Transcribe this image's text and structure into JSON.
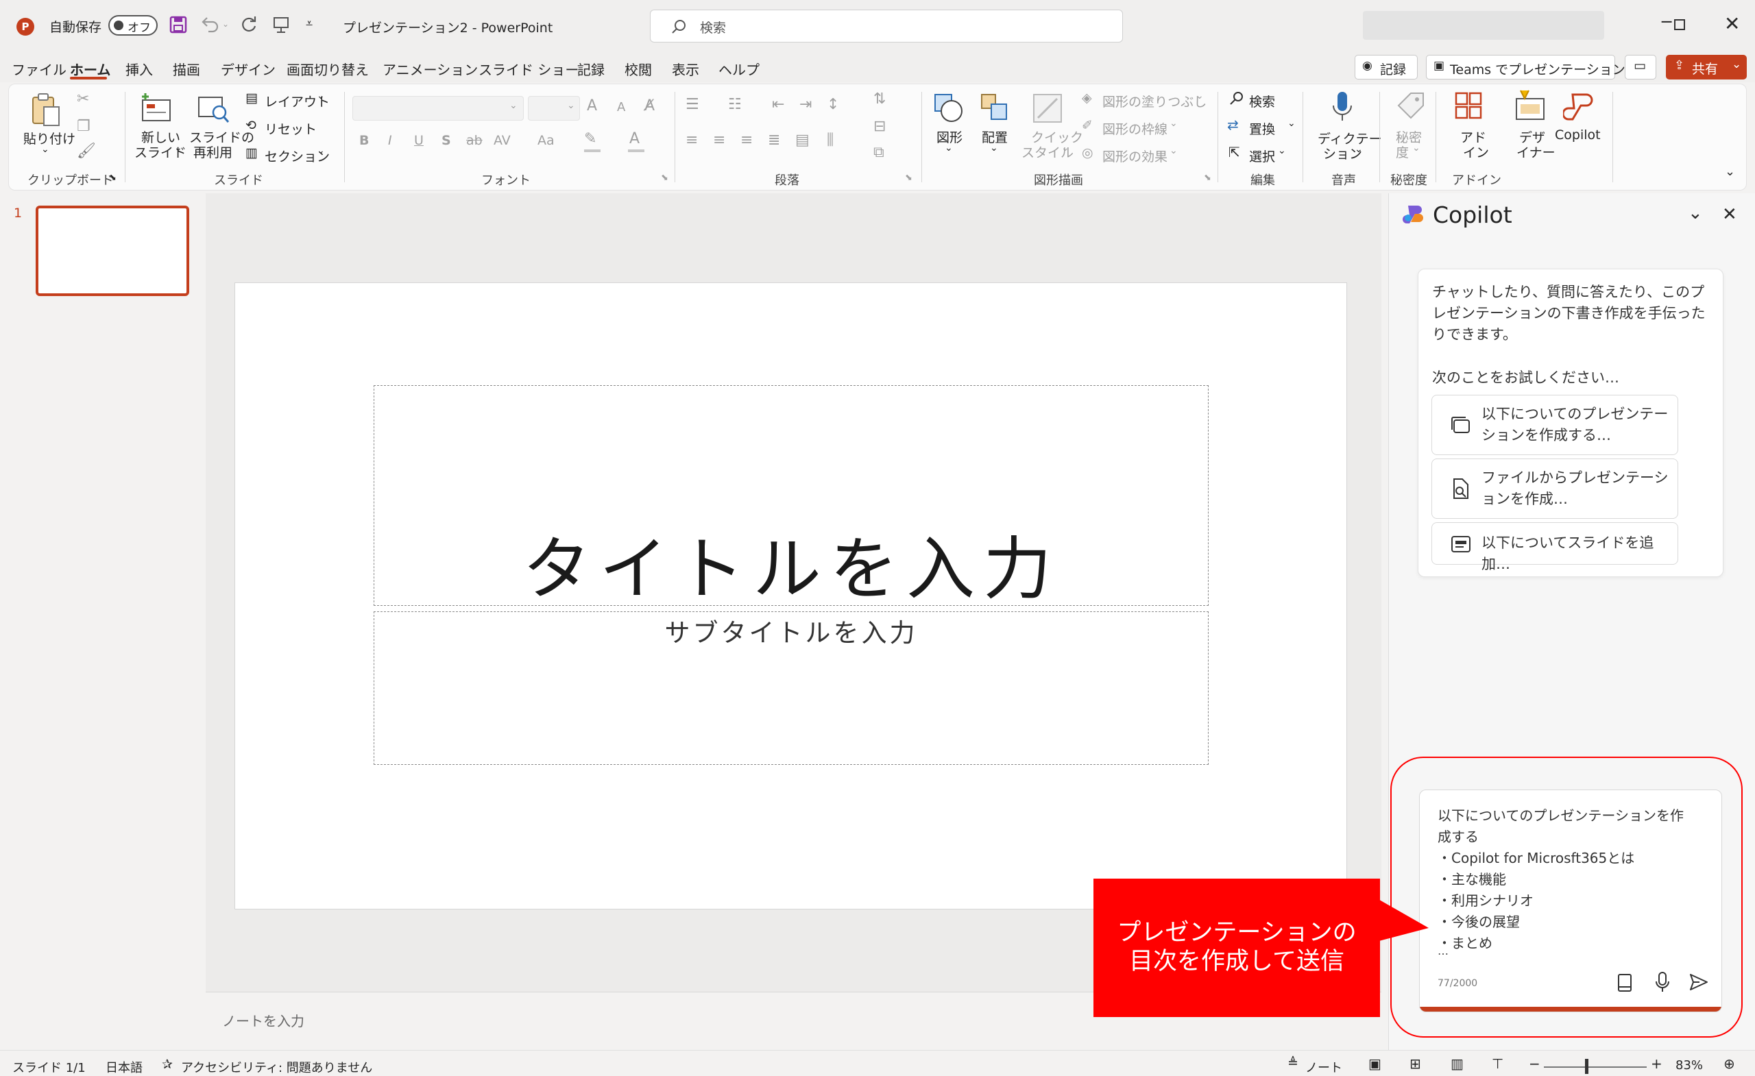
{
  "titlebar": {
    "autosave": "自動保存",
    "toggle": "オフ",
    "doc_title": "プレゼンテーション2 - PowerPoint",
    "search_placeholder": "検索"
  },
  "menu_tabs": [
    "ファイル",
    "ホーム",
    "挿入",
    "描画",
    "デザイン",
    "画面切り替え",
    "アニメーション",
    "スライド ショー",
    "記録",
    "校閲",
    "表示",
    "ヘルプ"
  ],
  "right_buttons": {
    "record": "記録",
    "teams": "Teams でプレゼンテーション",
    "share": "共有"
  },
  "ribbon": {
    "clipboard": {
      "paste": "貼り付け",
      "group": "クリップボード"
    },
    "slides": {
      "new_slide_1": "新しい",
      "new_slide_2": "スライド",
      "reuse_1": "スライドの",
      "reuse_2": "再利用",
      "layout": "レイアウト",
      "reset": "リセット",
      "section": "セクション",
      "group": "スライド"
    },
    "font": {
      "group": "フォント",
      "bold": "B",
      "italic": "I",
      "underline": "U",
      "shadow": "S",
      "strike": "ab",
      "spacing": "AV",
      "case": "Aa",
      "grow": "A",
      "shrink": "A"
    },
    "paragraph": {
      "group": "段落"
    },
    "drawing": {
      "shapes": "図形",
      "arrange": "配置",
      "quick_1": "クイック",
      "quick_2": "スタイル",
      "fill": "図形の塗りつぶし",
      "outline": "図形の枠線",
      "effect": "図形の効果",
      "group": "図形描画"
    },
    "editing": {
      "find": "検索",
      "replace": "置換",
      "select": "選択",
      "group": "編集"
    },
    "voice": {
      "dictate_1": "ディクテー",
      "dictate_2": "ション",
      "group": "音声"
    },
    "sensitivity": {
      "label_1": "秘密",
      "label_2": "度",
      "group": "秘密度"
    },
    "addins": {
      "label_1": "アド",
      "label_2": "イン",
      "designer_1": "デザ",
      "designer_2": "イナー",
      "copilot": "Copilot",
      "group": "アドイン"
    }
  },
  "slide_thumb": {
    "number": "1"
  },
  "slide": {
    "title_placeholder": "タイトルを入力",
    "subtitle_placeholder": "サブタイトルを入力"
  },
  "notes_placeholder": "ノートを入力",
  "copilot": {
    "title": "Copilot",
    "intro": "チャットしたり、質問に答えたり、このプレゼンテーションの下書き作成を手伝ったりできます。",
    "try_label": "次のことをお試しください…",
    "suggestions": [
      "以下についてのプレゼンテーションを作成する…",
      "ファイルからプレゼンテーションを作成…",
      "以下についてスライドを追加…"
    ],
    "input_lines": [
      "以下についてのプレゼンテーションを作",
      "成する",
      "・Copilot for Microsft365とは",
      "・主な機能",
      "・利用シナリオ",
      "・今後の展望",
      "・まとめ"
    ],
    "ellipsis": "…",
    "char_count": "77/2000"
  },
  "annotation": {
    "line1": "プレゼンテーションの",
    "line2": "目次を作成して送信",
    "color": "#ff0000"
  },
  "status": {
    "slide": "スライド 1/1",
    "lang": "日本語",
    "accessibility": "アクセシビリティ: 問題ありません",
    "notes": "ノート",
    "zoom": "83%",
    "minus": "−",
    "plus": "+"
  },
  "colors": {
    "accent": "#c43e1c",
    "share_bg": "#c43e1c",
    "callout": "#ff0000"
  }
}
